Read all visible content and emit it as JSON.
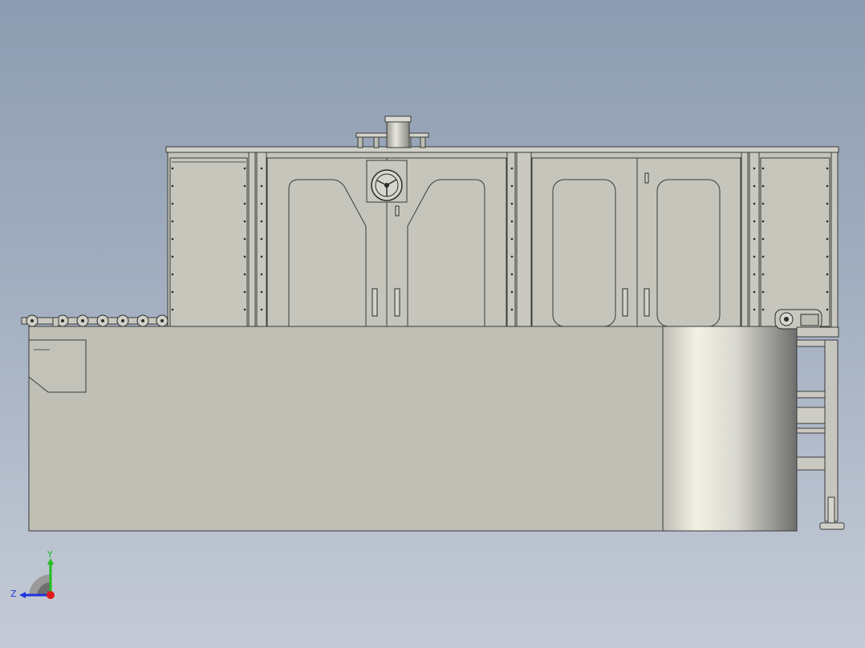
{
  "viewport": {
    "background_top": "#8d9cb1",
    "background_bottom": "#c4cbd6"
  },
  "model": {
    "frame_color": "#c3c3bb",
    "panel_color": "#c4c4bb",
    "edge_color": "#3a3a3a",
    "conveyor_color": "#bcbcb4"
  },
  "triad": {
    "y_label": "Y",
    "z_label": "Z",
    "y_color": "#1fbf1f",
    "z_color": "#2233dd",
    "x_color": "#e01b1b"
  }
}
